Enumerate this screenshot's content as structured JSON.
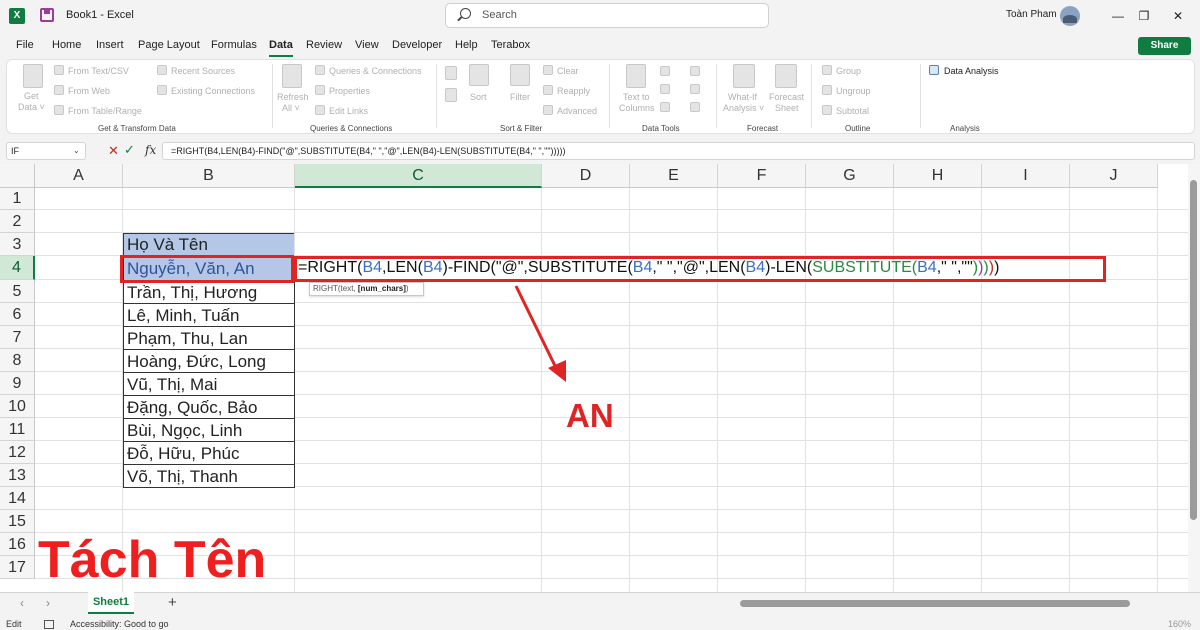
{
  "window": {
    "title": "Book1 - Excel",
    "search_placeholder": "Search",
    "user_name": "Toàn Pham",
    "app_logo": "X"
  },
  "menu": {
    "items": [
      "File",
      "Home",
      "Insert",
      "Page Layout",
      "Formulas",
      "Data",
      "Review",
      "View",
      "Developer",
      "Help",
      "Terabox"
    ],
    "active": "Data",
    "share_label": "Share"
  },
  "ribbon": {
    "get_transform": {
      "get_data": "Get",
      "get_data2": "Data ˅",
      "from_text": "From Text/CSV",
      "from_web": "From Web",
      "from_table": "From Table/Range",
      "recent_sources": "Recent Sources",
      "existing_connections": "Existing Connections",
      "label": "Get & Transform Data"
    },
    "queries": {
      "refresh": "Refresh",
      "refresh2": "All ˅",
      "queries_connections": "Queries & Connections",
      "properties": "Properties",
      "edit_links": "Edit Links",
      "label": "Queries & Connections"
    },
    "sort_filter": {
      "sort": "Sort",
      "filter": "Filter",
      "clear": "Clear",
      "reapply": "Reapply",
      "advanced": "Advanced",
      "label": "Sort & Filter"
    },
    "data_tools": {
      "text_to_columns": "Text to",
      "text_to_columns2": "Columns",
      "label": "Data Tools"
    },
    "forecast": {
      "what_if": "What-If",
      "what_if2": "Analysis ˅",
      "forecast_sheet": "Forecast",
      "forecast_sheet2": "Sheet",
      "label": "Forecast"
    },
    "outline": {
      "group": "Group",
      "ungroup": "Ungroup",
      "subtotal": "Subtotal",
      "label": "Outline"
    },
    "analysis": {
      "data_analysis": "Data Analysis",
      "label": "Analysis"
    }
  },
  "formula_bar": {
    "name_box": "IF",
    "cancel": "✕",
    "enter": "✓",
    "fx": "fx",
    "formula": "=RIGHT(B4,LEN(B4)-FIND(\"@\",SUBSTITUTE(B4,\" \",\"@\",LEN(B4)-LEN(SUBSTITUTE(B4,\" \",\"\")))))"
  },
  "grid": {
    "columns": [
      "A",
      "B",
      "C",
      "D",
      "E",
      "F",
      "G",
      "H",
      "I",
      "J"
    ],
    "selected_column": "C",
    "rows": [
      "1",
      "2",
      "3",
      "4",
      "5",
      "6",
      "7",
      "8",
      "9",
      "10",
      "11",
      "12",
      "13",
      "14",
      "15",
      "16",
      "17"
    ],
    "selected_row": "4",
    "b3_header": "Họ Và Tên",
    "names": [
      "Nguyễn, Văn, An",
      "Trần, Thị, Hương",
      "Lê, Minh, Tuấn",
      "Phạm, Thu, Lan",
      "Hoàng, Đức, Long",
      "Vũ, Thị, Mai",
      "Đặng, Quốc, Bảo",
      "Bùi, Ngọc, Linh",
      "Đỗ, Hữu, Phúc",
      "Võ, Thị, Thanh"
    ]
  },
  "formula_parts": [
    "=RIGHT(",
    "B4",
    ",LEN(",
    "B4",
    ")-FIND(\"@\",SUBSTITUTE(",
    "B4",
    ",\" \",\"@\",LEN(",
    "B4",
    ")-LEN(",
    "SUBSTITUTE(",
    "B4",
    ",\" \",\"\"",
    ")",
    ")",
    ")",
    ")",
    ")"
  ],
  "tooltip": {
    "fn": "RIGHT(text, ",
    "arg": "[num_chars]",
    "end": ")"
  },
  "annotation": {
    "result": "AN",
    "title": "Tách Tên",
    "colors": {
      "highlight_red": "#e02424",
      "excel_green": "#107c41"
    }
  },
  "sheets": {
    "tabs": [
      "Sheet1"
    ],
    "active": "Sheet1",
    "add": "+"
  },
  "status": {
    "mode": "Edit",
    "accessibility": "Accessibility: Good to go",
    "zoom": "160%"
  }
}
